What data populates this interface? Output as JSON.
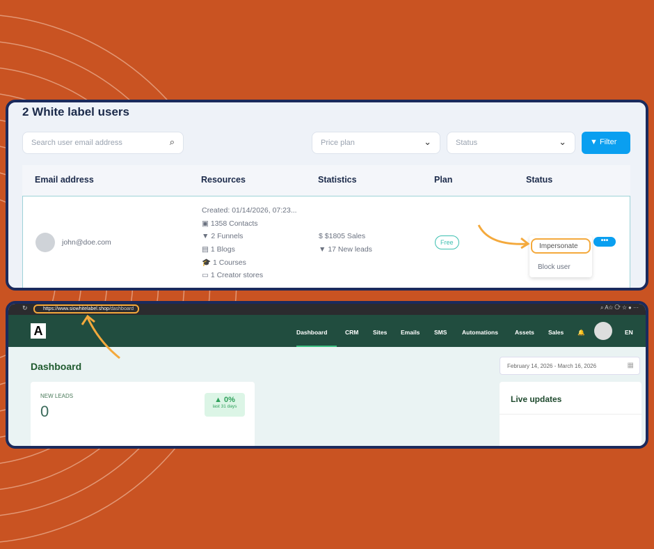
{
  "users": {
    "title": "2 White label users",
    "search_placeholder": "Search user email address",
    "price_plan": "Price plan",
    "status": "Status",
    "filter": "Filter",
    "columns": [
      "Email address",
      "Resources",
      "Statistics",
      "Plan",
      "Status"
    ],
    "row": {
      "email": "john@doe.com",
      "created": "Created: 01/14/2026, 07:23...",
      "resources": [
        "1358 Contacts",
        "2 Funnels",
        "1 Blogs",
        "1 Courses",
        "1 Creator stores"
      ],
      "stats": [
        "$1805 Sales",
        "17 New leads"
      ],
      "plan": "Free",
      "actions": [
        "Impersonate",
        "Block user"
      ],
      "more": "•••"
    }
  },
  "app": {
    "url_host": "https://www.siowhitelabel.shop",
    "url_path": "/dashboard",
    "logo": "A",
    "nav": [
      "Dashboard",
      "CRM",
      "Sites",
      "Emails",
      "SMS",
      "Automations",
      "Assets",
      "Sales"
    ],
    "lang": "EN",
    "page_title": "Dashboard",
    "date_range": "February 14, 2026 - March 16, 2026",
    "new_leads": {
      "label": "NEW LEADS",
      "value": "0",
      "change": "0%",
      "period": "last 31 days"
    },
    "live_updates": "Live updates"
  }
}
